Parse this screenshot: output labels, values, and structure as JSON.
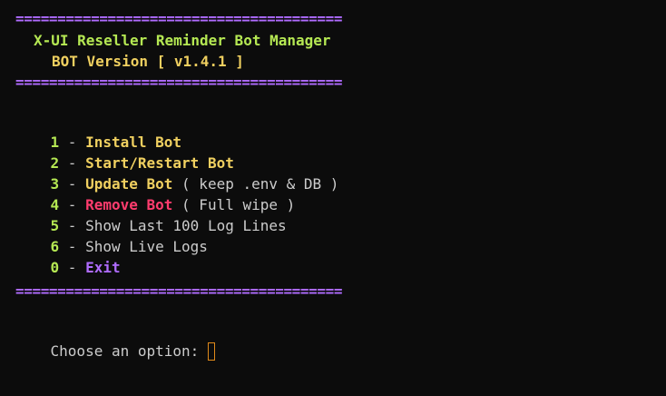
{
  "header": {
    "separator": "=======================================",
    "title": "X-UI Reseller Reminder Bot Manager",
    "version": "BOT Version [ v1.4.1 ]"
  },
  "menu": {
    "items": [
      {
        "num": "1",
        "dash": " - ",
        "label": "Install Bot",
        "note": ""
      },
      {
        "num": "2",
        "dash": " - ",
        "label": "Start/Restart Bot",
        "note": ""
      },
      {
        "num": "3",
        "dash": " - ",
        "label": "Update Bot",
        "note": " ( keep .env & DB )"
      },
      {
        "num": "4",
        "dash": " - ",
        "label": "Remove Bot",
        "note": " ( Full wipe )"
      },
      {
        "num": "5",
        "dash": " - ",
        "label": "Show Last 100 Log Lines",
        "note": ""
      },
      {
        "num": "6",
        "dash": " - ",
        "label": "Show Live Logs",
        "note": ""
      },
      {
        "num": "0",
        "dash": " - ",
        "label": "Exit",
        "note": ""
      }
    ]
  },
  "prompt": {
    "text": "Choose an option:"
  },
  "colors": {
    "background": "#0c0c0c",
    "separator": "#b06cff",
    "title": "#b5e853",
    "version": "#f0d060",
    "remove": "#ff3c6e",
    "cursor": "#e08a1a"
  }
}
